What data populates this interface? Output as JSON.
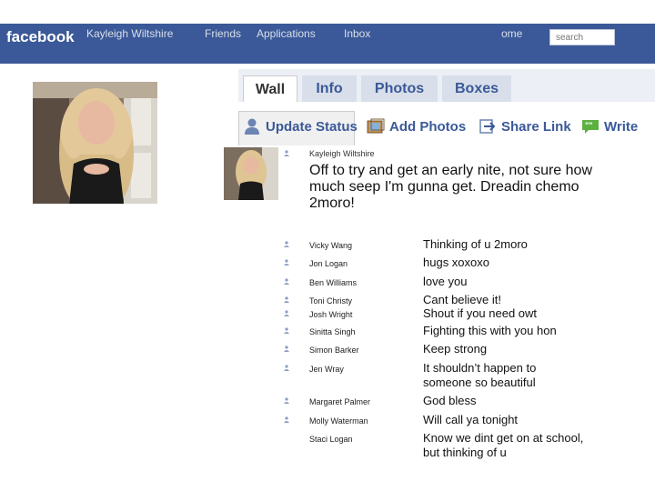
{
  "header": {
    "logo": "facebook",
    "user_name": "Kayleigh Wiltshire",
    "nav": [
      "Friends",
      "Applications",
      "Inbox",
      "ome"
    ],
    "search_placeholder": "search"
  },
  "tabs": [
    {
      "label": "Wall",
      "active": true
    },
    {
      "label": "Info",
      "active": false
    },
    {
      "label": "Photos",
      "active": false
    },
    {
      "label": "Boxes",
      "active": false
    }
  ],
  "toolbar": {
    "update_status": "Update Status",
    "add_photos": "Add Photos",
    "share_link": "Share Link",
    "write": "Write"
  },
  "post": {
    "author": "Kayleigh Wiltshire",
    "text": "Off to try and get an early nite, not sure how much seep I'm gunna get. Dreadin chemo 2moro!"
  },
  "comments": [
    {
      "name": "Vicky Wang",
      "text": "Thinking of u 2moro"
    },
    {
      "name": "Jon Logan",
      "text": "hugs xoxoxo"
    },
    {
      "name": "Ben Williams",
      "text": "love you"
    },
    {
      "name": "Toni Christy",
      "text": "Cant believe it!"
    },
    {
      "name": "Josh Wright",
      "text": "Shout if you need owt"
    },
    {
      "name": "Sinitta Singh",
      "text": "Fighting this with you hon"
    },
    {
      "name": "Simon Barker",
      "text": "Keep strong"
    },
    {
      "name": "Jen Wray",
      "text": "It shouldn’t happen to someone so beautiful"
    },
    {
      "name": "Margaret Palmer",
      "text": "God bless"
    },
    {
      "name": "Molly Waterman",
      "text": "Will call ya tonight"
    },
    {
      "name": "Staci Logan",
      "text": "Know we dint get on at school, but thinking of u"
    }
  ],
  "colors": {
    "brand": "#3b5998",
    "tab_bg": "#d8dfea"
  }
}
